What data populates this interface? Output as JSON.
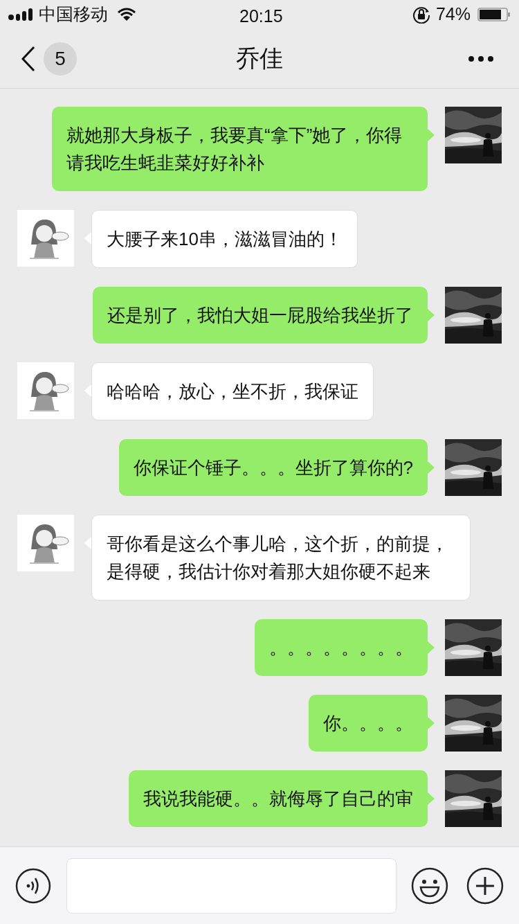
{
  "status_bar": {
    "carrier": "中国移动",
    "time": "20:15",
    "battery": "74%"
  },
  "header": {
    "unread_count": "5",
    "title": "乔佳"
  },
  "messages": [
    {
      "kind": "sent",
      "text": "就她那大身板子，我要真“拿下”她了，你得请我吃生蚝韭菜好好补补"
    },
    {
      "kind": "received",
      "text": "大腰子来10串，滋滋冒油的！"
    },
    {
      "kind": "sent",
      "text": "还是别了，我怕大姐一屁股给我坐折了"
    },
    {
      "kind": "received",
      "text": "哈哈哈，放心，坐不折，我保证"
    },
    {
      "kind": "sent",
      "text": "你保证个锤子。。。坐折了算你的?"
    },
    {
      "kind": "received",
      "text": "哥你看是这么个事儿哈，这个折，的前提，是得硬，我估计你对着那大姐你硬不起来"
    },
    {
      "kind": "sent",
      "text": "。。。。。。。。"
    },
    {
      "kind": "sent",
      "text": "你。。。。"
    },
    {
      "kind": "sent",
      "text": "我说我能硬。。就侮辱了自己的审"
    }
  ]
}
